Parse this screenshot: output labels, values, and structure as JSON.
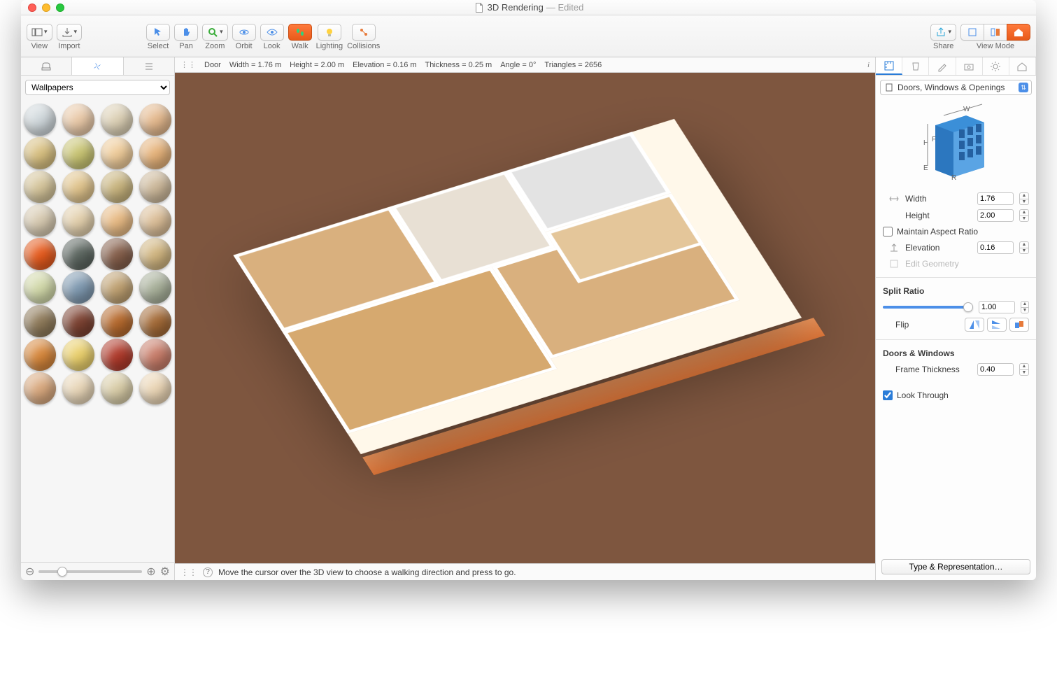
{
  "title": "3D Rendering",
  "edited_suffix": "— Edited",
  "toolbar": {
    "view": "View",
    "import": "Import",
    "select": "Select",
    "pan": "Pan",
    "zoom": "Zoom",
    "orbit": "Orbit",
    "look": "Look",
    "walk": "Walk",
    "lighting": "Lighting",
    "collisions": "Collisions",
    "share": "Share",
    "viewmode": "View Mode"
  },
  "left": {
    "dropdown": "Wallpapers",
    "swatch_colors": [
      [
        "#cfd7db",
        "#e9c9a8",
        "#dcd0b5",
        "#e4b98e"
      ],
      [
        "#d7bf80",
        "#c8c473",
        "#eecb99",
        "#e5b27a"
      ],
      [
        "#d4c49a",
        "#e0c48d",
        "#c8b47e",
        "#ccb89a"
      ],
      [
        "#d6c9b0",
        "#e2cfac",
        "#e7ba84",
        "#dbbe98"
      ],
      [
        "#e55b1e",
        "#5c6660",
        "#855f4b",
        "#d0b580"
      ],
      [
        "#d1d8a9",
        "#7f99b0",
        "#bfa172",
        "#a8b09a"
      ],
      [
        "#8e7a5a",
        "#7c4232",
        "#b66a2e",
        "#a46b38"
      ],
      [
        "#d6873c",
        "#e9cf6c",
        "#b03b2c",
        "#c87d6a"
      ],
      [
        "#d8a87e",
        "#e8d6b8",
        "#d9cda8",
        "#ead5b5"
      ]
    ]
  },
  "infobar": {
    "object": "Door",
    "width": "Width = 1.76 m",
    "height": "Height = 2.00 m",
    "elevation": "Elevation = 0.16 m",
    "thickness": "Thickness = 0.25 m",
    "angle": "Angle = 0°",
    "triangles": "Triangles = 2656"
  },
  "statusbar": "Move the cursor over the 3D view to choose a walking direction and press to go.",
  "inspector": {
    "category": "Doors, Windows & Openings",
    "width_label": "Width",
    "width_value": "1.76",
    "height_label": "Height",
    "height_value": "2.00",
    "maintain_aspect": "Maintain Aspect Ratio",
    "elevation_label": "Elevation",
    "elevation_value": "0.16",
    "edit_geometry": "Edit Geometry",
    "split_ratio_hdr": "Split Ratio",
    "split_ratio_value": "1.00",
    "flip_label": "Flip",
    "doors_windows_hdr": "Doors & Windows",
    "frame_thickness_label": "Frame Thickness",
    "frame_thickness_value": "0.40",
    "look_through": "Look Through",
    "type_rep": "Type & Representation…"
  }
}
